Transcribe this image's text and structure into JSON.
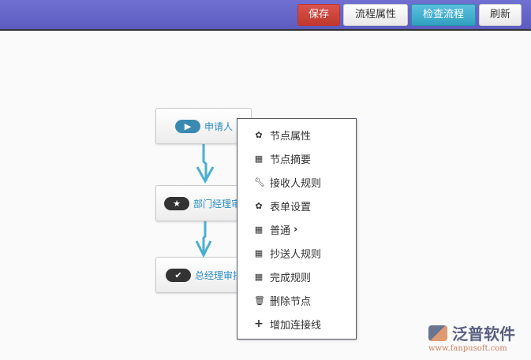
{
  "toolbar": {
    "save": "保存",
    "flow_props": "流程属性",
    "check_flow": "检查流程",
    "refresh": "刷新"
  },
  "nodes": [
    {
      "label": "申请人",
      "icon": "play-icon"
    },
    {
      "label": "部门经理审批",
      "icon": "star-icon"
    },
    {
      "label": "总经理审批",
      "icon": "check-icon"
    }
  ],
  "menu": [
    {
      "label": "节点属性",
      "icon": "gear-icon"
    },
    {
      "label": "节点摘要",
      "icon": "grid-icon"
    },
    {
      "label": "接收人规则",
      "icon": "wrench-icon"
    },
    {
      "label": "表单设置",
      "icon": "gear-icon"
    },
    {
      "label": "普通",
      "icon": "grid-icon"
    },
    {
      "label": "抄送人规则",
      "icon": "grid-icon"
    },
    {
      "label": "完成规则",
      "icon": "grid-icon"
    },
    {
      "label": "删除节点",
      "icon": "trash-icon"
    },
    {
      "label": "增加连接线",
      "icon": "plus-icon"
    }
  ],
  "logo": {
    "name": "泛普软件",
    "url": "www.fanpusoft.com"
  },
  "colors": {
    "accent": "#4ab0d0",
    "save": "#d9534f",
    "check": "#5bc0de"
  }
}
